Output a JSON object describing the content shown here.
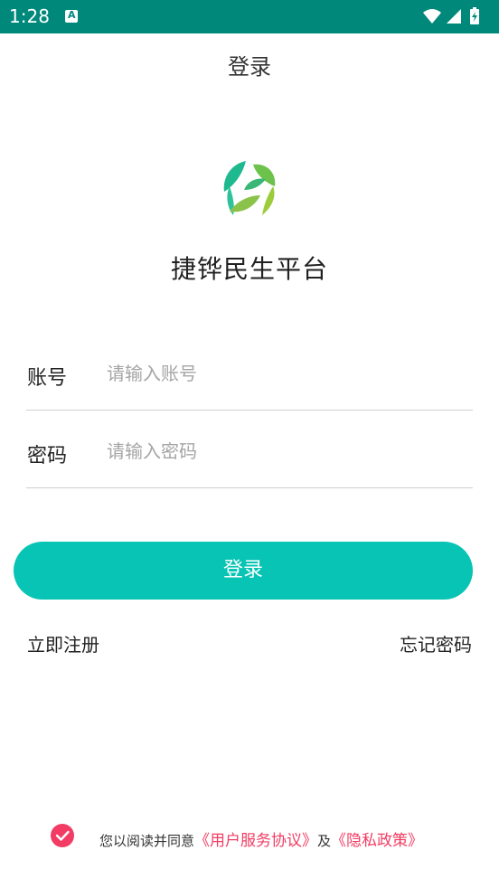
{
  "status_bar": {
    "time": "1:28",
    "bg_color": "#00897b"
  },
  "header": {
    "title": "登录"
  },
  "brand": {
    "app_name": "捷铧民生平台",
    "logo_icon": "leaf-logo-icon"
  },
  "form": {
    "account": {
      "label": "账号",
      "placeholder": "请输入账号",
      "value": ""
    },
    "password": {
      "label": "密码",
      "placeholder": "请输入密码",
      "value": ""
    }
  },
  "actions": {
    "login_label": "登录",
    "register_label": "立即注册",
    "forgot_label": "忘记密码",
    "accent": "#07c4b5"
  },
  "agreement": {
    "checked": true,
    "prefix": "您以阅读并同意",
    "terms": "《用户服务协议》",
    "conjunction": "及",
    "privacy": "《隐私政策》",
    "link_color": "#f23c63"
  }
}
